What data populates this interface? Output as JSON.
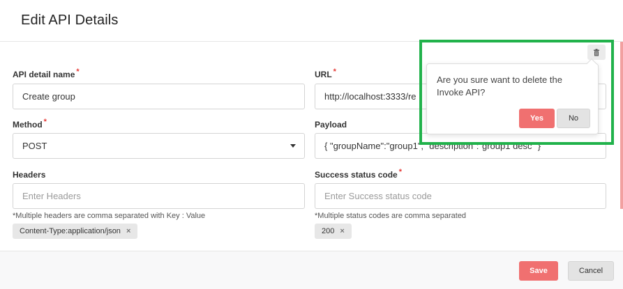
{
  "modal": {
    "title": "Edit API Details"
  },
  "form": {
    "name": {
      "label": "API detail name",
      "required_mark": "*",
      "value": "Create group"
    },
    "url": {
      "label": "URL",
      "required_mark": "*",
      "value": "http://localhost:3333/re"
    },
    "method": {
      "label": "Method",
      "required_mark": "*",
      "value": "POST"
    },
    "payload": {
      "label": "Payload",
      "value": "{    \"groupName\":\"group1\", \"description\":\"group1 desc\" }"
    },
    "headers": {
      "label": "Headers",
      "placeholder": "Enter Headers",
      "hint": "*Multiple headers are comma separated with Key : Value",
      "chips": [
        {
          "label": "Content-Type:application/json",
          "remove": "×"
        }
      ]
    },
    "success_code": {
      "label": "Success status code",
      "required_mark": "*",
      "placeholder": "Enter Success status code",
      "hint": "*Multiple status codes are comma separated",
      "chips": [
        {
          "label": "200",
          "remove": "×"
        }
      ]
    }
  },
  "footer": {
    "save_label": "Save",
    "cancel_label": "Cancel"
  },
  "delete_popover": {
    "message": "Are you sure want to delete the Invoke API?",
    "yes_label": "Yes",
    "no_label": "No",
    "trigger_icon": "trash-icon"
  },
  "colors": {
    "primary": "#f07070",
    "required": "#e53935",
    "highlight": "#21b24b"
  }
}
